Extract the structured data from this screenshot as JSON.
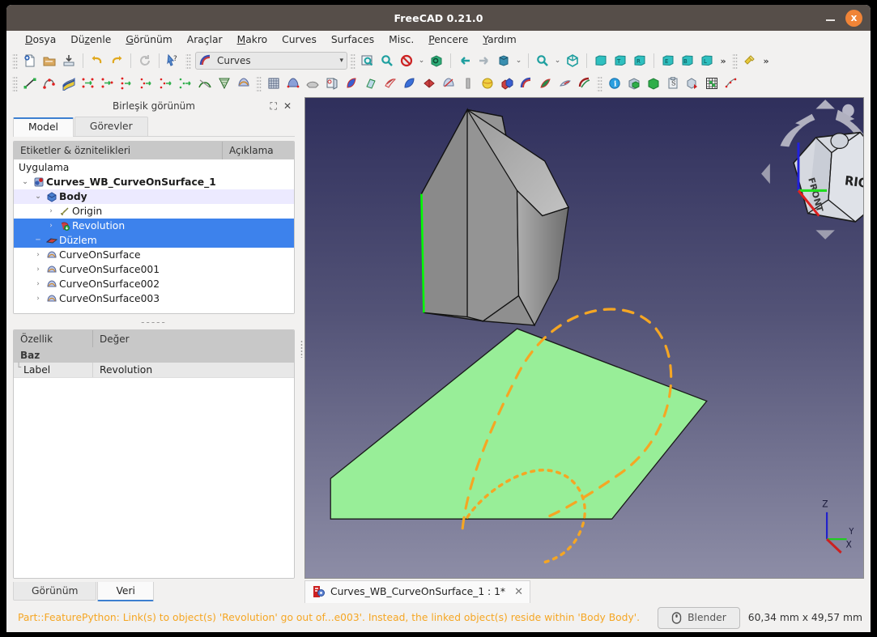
{
  "window": {
    "title": "FreeCAD 0.21.0",
    "minimize_label": "_",
    "close_label": "x"
  },
  "menu": [
    {
      "label": "Dosya",
      "mnemonic": "D"
    },
    {
      "label": "Düzenle",
      "mnemonic": "z"
    },
    {
      "label": "Görünüm",
      "mnemonic": "G"
    },
    {
      "label": "Araçlar",
      "mnemonic": ""
    },
    {
      "label": "Makro",
      "mnemonic": "M"
    },
    {
      "label": "Curves",
      "mnemonic": ""
    },
    {
      "label": "Surfaces",
      "mnemonic": ""
    },
    {
      "label": "Misc.",
      "mnemonic": ""
    },
    {
      "label": "Pencere",
      "mnemonic": "P"
    },
    {
      "label": "Yardım",
      "mnemonic": "Y"
    }
  ],
  "workbench": {
    "selected": "Curves",
    "arrow": "▾"
  },
  "toolbar_overflow": "»",
  "panel": {
    "title": "Birleşik görünüm",
    "float_icon": "⛶",
    "close_icon": "✕",
    "tabs": [
      {
        "label": "Model",
        "active": true
      },
      {
        "label": "Görevler",
        "active": false
      }
    ],
    "tree_headers": {
      "labels": "Etiketler & öznitelikleri",
      "description": "Açıklama"
    },
    "tree": [
      {
        "label": "Uygulama",
        "depth": 0,
        "icon": "none",
        "state": "none",
        "expander": ""
      },
      {
        "label": "Curves_WB_CurveOnSurface_1",
        "depth": 1,
        "icon": "document",
        "state": "bold",
        "expander": "⌄"
      },
      {
        "label": "Body",
        "depth": 2,
        "icon": "body",
        "state": "highlight",
        "expander": "⌄"
      },
      {
        "label": "Origin",
        "depth": 3,
        "icon": "origin",
        "state": "none",
        "expander": "›"
      },
      {
        "label": "Revolution",
        "depth": 3,
        "icon": "revolution",
        "state": "selected",
        "expander": "›"
      },
      {
        "label": "Düzlem",
        "depth": 2,
        "icon": "plane",
        "state": "selected",
        "expander": ""
      },
      {
        "label": "CurveOnSurface",
        "depth": 2,
        "icon": "surface",
        "state": "none",
        "expander": "›"
      },
      {
        "label": "CurveOnSurface001",
        "depth": 2,
        "icon": "surface",
        "state": "none",
        "expander": "›"
      },
      {
        "label": "CurveOnSurface002",
        "depth": 2,
        "icon": "surface",
        "state": "none",
        "expander": "›"
      },
      {
        "label": "CurveOnSurface003",
        "depth": 2,
        "icon": "surface",
        "state": "none",
        "expander": "›"
      }
    ],
    "separator": "-----",
    "property_headers": {
      "property": "Özellik",
      "value": "Değer"
    },
    "property_group": "Baz",
    "property_rows": [
      {
        "name": "Label",
        "value": "Revolution"
      }
    ],
    "bottom_tabs": [
      {
        "label": "Görünüm",
        "active": false
      },
      {
        "label": "Veri",
        "active": true
      }
    ]
  },
  "view": {
    "navcube": {
      "front_face": "FRONT",
      "right_face": "RIGHT"
    },
    "axis": {
      "x": "X",
      "y": "Y",
      "z": "Z"
    },
    "document_tab": {
      "label": "Curves_WB_CurveOnSurface_1 : 1*",
      "close": "✕"
    }
  },
  "status": {
    "message": "Part::FeaturePython: Link(s) to object(s) 'Revolution' go out of...e003'. Instead, the linked object(s) reside within 'Body Body'.",
    "blender_button": "Blender",
    "dimensions": "60,34 mm x 49,57 mm"
  },
  "colors": {
    "accent": "#3d82ec",
    "title_bar": "#564e49",
    "close_button": "#f08437",
    "status_text": "#f5a623",
    "plane_green": "#98ee98",
    "curve_orange": "#f5a623",
    "edge_green": "#00ff00"
  }
}
